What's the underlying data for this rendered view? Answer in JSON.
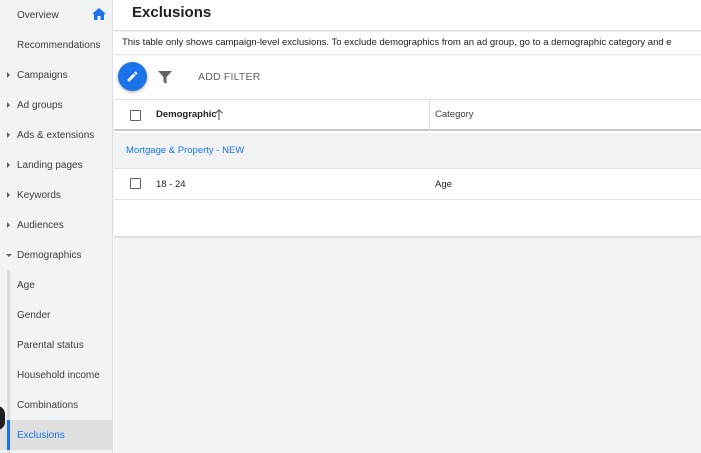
{
  "sidebar": {
    "items": [
      {
        "label": "Overview",
        "type": "top"
      },
      {
        "label": "Recommendations",
        "type": "top"
      },
      {
        "label": "Campaigns",
        "type": "expandable"
      },
      {
        "label": "Ad groups",
        "type": "expandable"
      },
      {
        "label": "Ads & extensions",
        "type": "expandable"
      },
      {
        "label": "Landing pages",
        "type": "expandable"
      },
      {
        "label": "Keywords",
        "type": "expandable"
      },
      {
        "label": "Audiences",
        "type": "expandable"
      },
      {
        "label": "Demographics",
        "type": "expandable-open"
      },
      {
        "label": "Age",
        "type": "sub"
      },
      {
        "label": "Gender",
        "type": "sub"
      },
      {
        "label": "Parental status",
        "type": "sub"
      },
      {
        "label": "Household income",
        "type": "sub"
      },
      {
        "label": "Combinations",
        "type": "sub"
      },
      {
        "label": "Exclusions",
        "type": "sub-active"
      }
    ],
    "home_icon": "home-icon"
  },
  "header": {
    "title": "Exclusions"
  },
  "info": {
    "text": "This table only shows campaign-level exclusions. To exclude demographics from an ad group, go to a demographic category and e"
  },
  "toolbar": {
    "edit_icon": "pencil-icon",
    "filter_icon": "filter-icon",
    "add_filter_label": "ADD FILTER"
  },
  "table": {
    "columns": {
      "demographic": "Demographic",
      "category": "Category"
    },
    "sort_icon": "arrow-up-icon",
    "group": {
      "label": "Mortgage & Property - NEW"
    },
    "rows": [
      {
        "demographic": "18 - 24",
        "category": "Age"
      }
    ]
  },
  "colors": {
    "accent": "#1a73e8",
    "sidebar_bg": "#f1f3f4",
    "text": "#3c4043"
  }
}
